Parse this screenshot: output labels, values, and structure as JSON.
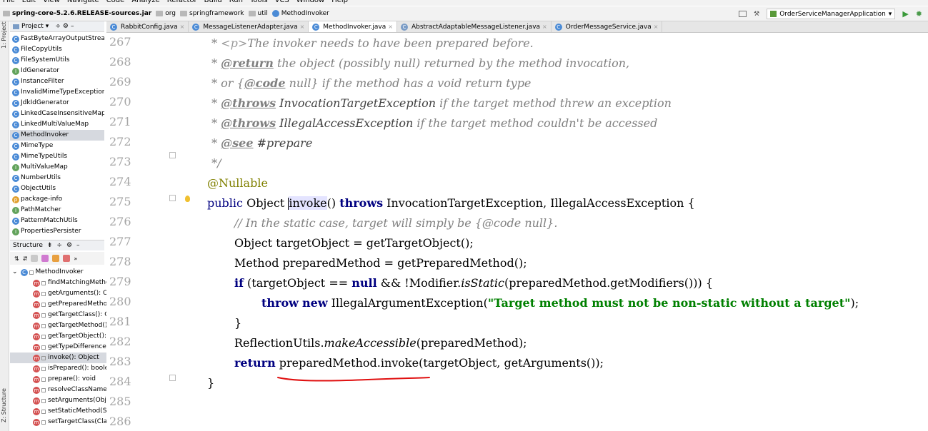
{
  "menu": [
    "File",
    "Edit",
    "View",
    "Navigate",
    "Code",
    "Analyze",
    "Refactor",
    "Build",
    "Run",
    "Tools",
    "VCS",
    "Window",
    "Help"
  ],
  "breadcrumbs": [
    "spring-core-5.2.6.RELEASE-sources.jar",
    "org",
    "springframework",
    "util",
    "MethodInvoker"
  ],
  "run_config": "OrderServiceManagerApplication",
  "left_tool_labels": {
    "project": "1: Project",
    "structure": "Z: Structure"
  },
  "project_panel": {
    "title": "Project",
    "items": [
      "FastByteArrayOutputStream",
      "FileCopyUtils",
      "FileSystemUtils",
      "IdGenerator",
      "InstanceFilter",
      "InvalidMimeTypeException",
      "JdkIdGenerator",
      "LinkedCaseInsensitiveMap",
      "LinkedMultiValueMap",
      "MethodInvoker",
      "MimeType",
      "MimeTypeUtils",
      "MultiValueMap",
      "NumberUtils",
      "ObjectUtils",
      "package-info",
      "PathMatcher",
      "PatternMatchUtils",
      "PropertiesPersister"
    ],
    "selected_index": 9
  },
  "structure_panel": {
    "title": "Structure",
    "root": "MethodInvoker",
    "items": [
      "findMatchingMetho",
      "getArguments(): Ol",
      "getPreparedMetho",
      "getTargetClass(): C",
      "getTargetMethod()",
      "getTargetObject():",
      "getTypeDifference\\",
      "invoke(): Object",
      "isPrepared(): boole",
      "prepare(): void",
      "resolveClassName(",
      "setArguments(Obje",
      "setStaticMethod(St",
      "setTargetClass(Clas"
    ],
    "selected_index": 7
  },
  "tabs": [
    {
      "label": "RabbitConfig.java",
      "active": false
    },
    {
      "label": "MessageListenerAdapter.java",
      "active": false
    },
    {
      "label": "MethodInvoker.java",
      "active": true
    },
    {
      "label": "AbstractAdaptableMessageListener.java",
      "active": false
    },
    {
      "label": "OrderMessageService.java",
      "active": false
    }
  ],
  "editor": {
    "line_numbers": [
      "267",
      "268",
      "269",
      "270",
      "271",
      "272",
      "273",
      "274",
      "275",
      "276",
      "277",
      "278",
      "279",
      "280",
      "281",
      "282",
      "283",
      "284",
      "285",
      "286"
    ],
    "code": {
      "l267": {
        "star": " * ",
        "tag": "<p>",
        "text": "The invoker needs to have been prepared before."
      },
      "l268": {
        "star": " * ",
        "tag": "@return",
        "text": " the object (possibly null) returned by the method invocation,"
      },
      "l269": {
        "pre": " * or {",
        "tag": "@code",
        "text": " null} if the method has a void return type"
      },
      "l270": {
        "star": " * ",
        "tag": "@throws",
        "name": " InvocationTargetException",
        "text": " if the target method threw an exception"
      },
      "l271": {
        "star": " * ",
        "tag": "@throws",
        "name": " IllegalAccessException",
        "text": " if the target method couldn't be accessed"
      },
      "l272": {
        "star": " * ",
        "tag": "@see",
        "text": " #prepare"
      },
      "l273": {
        "text": " */"
      },
      "l274": {
        "text": "@Nullable"
      },
      "l275": {
        "kw1": "public",
        "t1": " Object ",
        "name": "invoke",
        "t2": "() ",
        "kw2": "throws",
        "t3": " InvocationTargetException, IllegalAccessException {"
      },
      "l276": {
        "text": "// In the static case, target will simply be {@code null}."
      },
      "l277": {
        "text": "Object targetObject = getTargetObject();"
      },
      "l278": {
        "text": "Method preparedMethod = getPreparedMethod();"
      },
      "l279": {
        "kw1": "if",
        "t1": " (targetObject == ",
        "kw2": "null",
        "t2": " && !Modifier.",
        "st": "isStatic",
        "t3": "(preparedMethod.getModifiers())) {"
      },
      "l280": {
        "kw1": "throw",
        "kw2": "new",
        "t1": " IllegalArgumentException(",
        "str": "\"Target method must not be non-static without a target\"",
        "t2": ");"
      },
      "l281": {
        "text": "}"
      },
      "l282": {
        "t1": "ReflectionUtils.",
        "st": "makeAccessible",
        "t2": "(preparedMethod);"
      },
      "l283": {
        "kw1": "return",
        "t1": " preparedMethod.invoke(targetObject, getArguments());"
      },
      "l284": {
        "text": "}"
      }
    }
  },
  "colors": {
    "keyword": "#000080",
    "comment": "#808080",
    "string": "#008000",
    "annotation": "#808000",
    "annotation_mark": "#e01010",
    "selection": "#d6d9df"
  }
}
